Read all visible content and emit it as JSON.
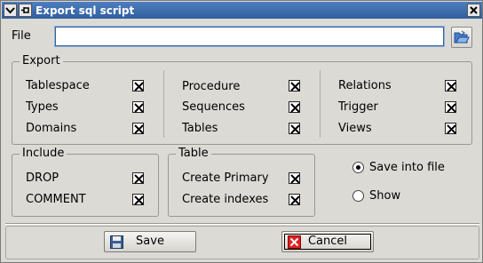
{
  "window": {
    "title": "Export sql script",
    "menu_icon": "chevron-down-icon",
    "pin_icon": "pin-icon",
    "close_icon": "close-icon"
  },
  "file": {
    "label": "File",
    "value": "",
    "browse_icon": "folder-open-icon"
  },
  "export": {
    "title": "Export",
    "col1": [
      {
        "label": "Tablespace",
        "checked": true
      },
      {
        "label": "Types",
        "checked": true
      },
      {
        "label": "Domains",
        "checked": true
      }
    ],
    "col2": [
      {
        "label": "Procedure",
        "checked": true
      },
      {
        "label": "Sequences",
        "checked": true
      },
      {
        "label": "Tables",
        "checked": true
      }
    ],
    "col3": [
      {
        "label": "Relations",
        "checked": true
      },
      {
        "label": "Trigger",
        "checked": true
      },
      {
        "label": "Views",
        "checked": true
      }
    ]
  },
  "include": {
    "title": "Include",
    "items": [
      {
        "label": "DROP",
        "checked": true
      },
      {
        "label": "COMMENT",
        "checked": true
      }
    ]
  },
  "table": {
    "title": "Table",
    "items": [
      {
        "label": "Create Primary",
        "checked": true
      },
      {
        "label": "Create indexes",
        "checked": true
      }
    ]
  },
  "output": {
    "options": [
      {
        "label": "Save into file",
        "selected": true
      },
      {
        "label": "Show",
        "selected": false
      }
    ]
  },
  "buttons": {
    "save": {
      "label": "Save",
      "icon": "floppy-disk-icon"
    },
    "cancel": {
      "label": "Cancel",
      "icon": "cancel-icon"
    }
  }
}
